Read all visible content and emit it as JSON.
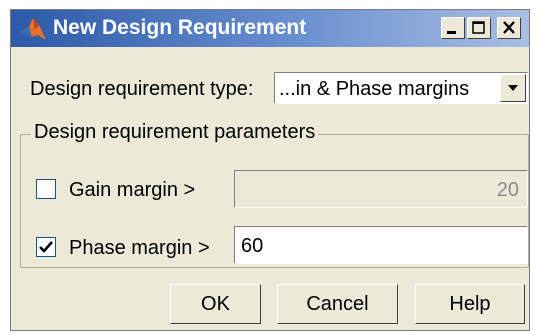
{
  "window": {
    "title": "New Design Requirement"
  },
  "requirement_type": {
    "label": "Design requirement type:",
    "selected": "...in & Phase margins"
  },
  "parameters": {
    "group_title": "Design requirement parameters",
    "gain_margin": {
      "label": "Gain margin >",
      "checked": false,
      "value": "20",
      "enabled": false
    },
    "phase_margin": {
      "label": "Phase margin >",
      "checked": true,
      "value": "60",
      "enabled": true
    }
  },
  "buttons": {
    "ok": "OK",
    "cancel": "Cancel",
    "help": "Help"
  },
  "colors": {
    "title_bar_start": "#2c5aa8",
    "title_bar_end": "#a9bfe3",
    "dialog_background": "#ece9d8"
  },
  "icons": {
    "app": "matlab-logo-icon",
    "minimize": "minimize-icon",
    "maximize": "maximize-icon",
    "close": "close-icon",
    "dropdown": "chevron-down-icon",
    "check": "checkmark-icon"
  }
}
